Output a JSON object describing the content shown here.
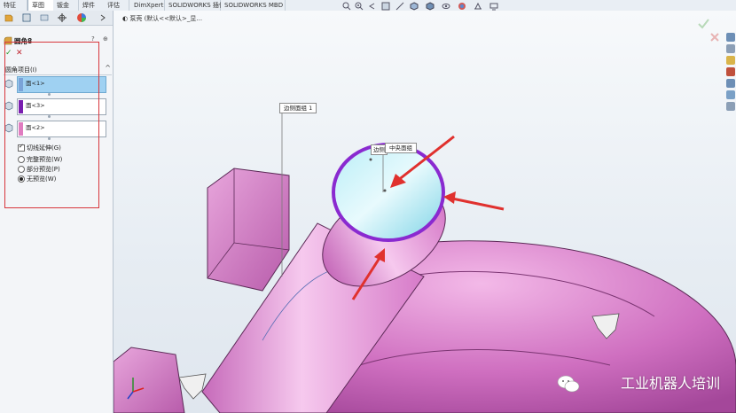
{
  "tabs": [
    "特征",
    "草图",
    "钣金",
    "焊件",
    "评估",
    "DimXpert",
    "SOLIDWORKS 插件",
    "SOLIDWORKS MBD"
  ],
  "active_tab_index": 1,
  "property_manager": {
    "title": "圆角8",
    "help": "?",
    "pin": "⊕",
    "ok": "✓",
    "cancel": "✕",
    "group_title": "圆角项目(I)",
    "collapse": "^",
    "selections": [
      {
        "label": "面<1>",
        "color": "#7aa3d8",
        "highlighted": true
      },
      {
        "label": "面<3>",
        "color": "#7a1fb0",
        "highlighted": false
      },
      {
        "label": "面<2>",
        "color": "#e07cc0",
        "highlighted": false
      }
    ],
    "tangent_propagation": "切线延伸(G)",
    "options": [
      "完整预览(W)",
      "部分预览(P)",
      "无预览(W)"
    ],
    "selected_option_index": 2
  },
  "breadcrumb": "泵壳 (默认<<默认>_显...",
  "callouts": {
    "side_face": "边侧面组 1",
    "center_face": "中央面组",
    "small": "边侧"
  },
  "watermark": "工业机器人培训",
  "colors": {
    "part_pink": "#e39ad6",
    "edge_purple": "#8a2ad0",
    "arrow_red": "#e0312e",
    "highlight_box": "#d8363c"
  }
}
